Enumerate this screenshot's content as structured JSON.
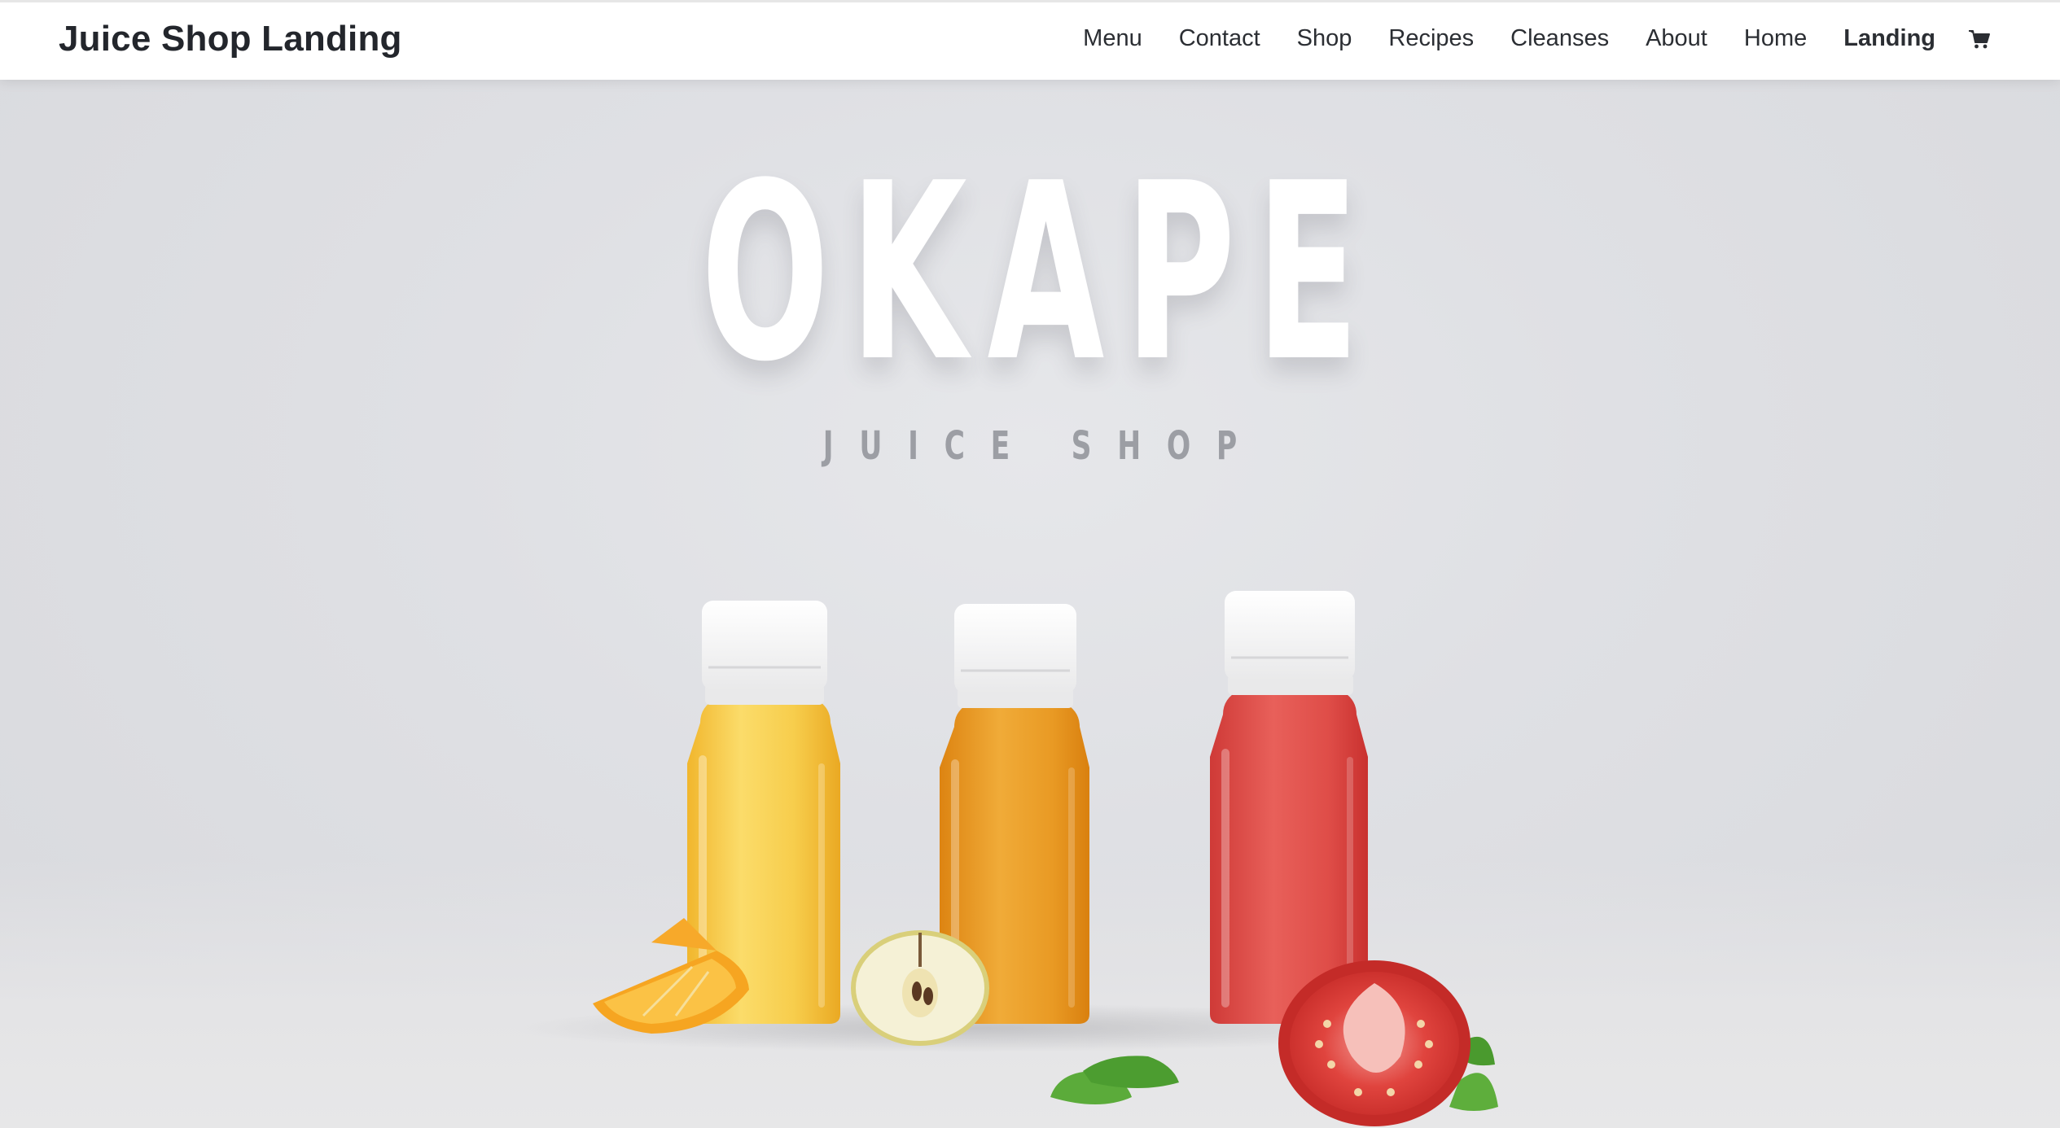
{
  "header": {
    "site_title": "Juice Shop Landing",
    "nav": [
      {
        "label": "Menu"
      },
      {
        "label": "Contact"
      },
      {
        "label": "Shop"
      },
      {
        "label": "Recipes"
      },
      {
        "label": "Cleanses"
      },
      {
        "label": "About"
      },
      {
        "label": "Home"
      },
      {
        "label": "Landing",
        "active": true
      }
    ],
    "cart_icon": "shopping-cart-icon"
  },
  "hero": {
    "title": "OKAPE",
    "subtitle": "JUICE SHOP",
    "image": "juice-bottles-photo"
  },
  "colors": {
    "header_bg": "#ffffff",
    "text_dark": "#23262c",
    "hero_bg": "#dfe0e4",
    "title_color": "#ffffff",
    "subtitle_color": "#9c9ea4",
    "orange_juice": "#f6c53c",
    "carrot_juice": "#e7961f",
    "tomato_juice": "#dd4a44"
  }
}
